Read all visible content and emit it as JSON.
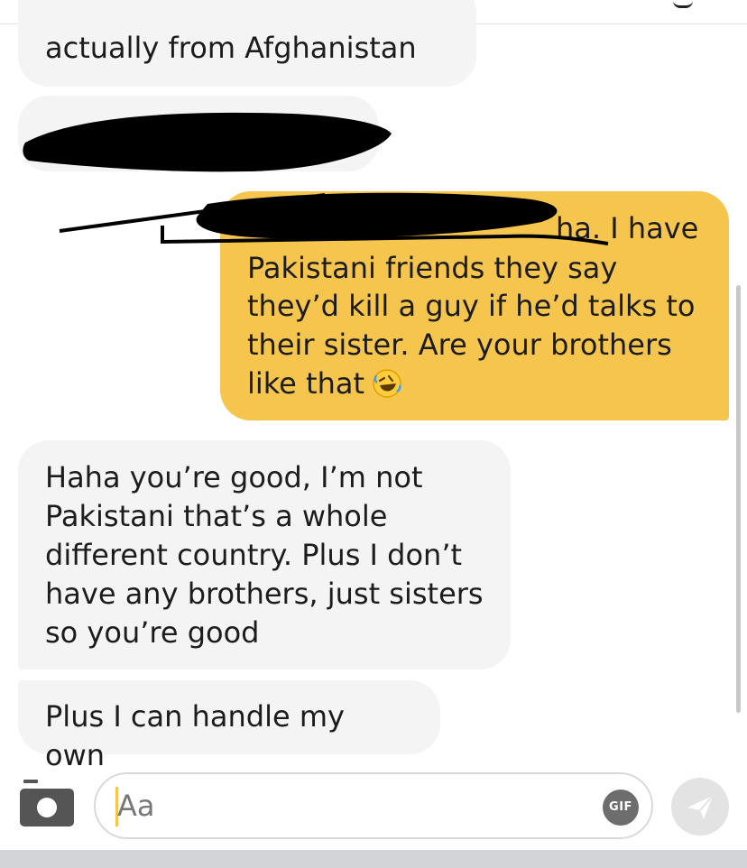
{
  "messages": [
    {
      "id": "msg1",
      "direction": "incoming",
      "text": "actually from Afghanistan"
    },
    {
      "id": "msg2",
      "direction": "incoming",
      "text": "",
      "redacted": true
    },
    {
      "id": "msg3",
      "direction": "outgoing",
      "line1": "ha. I have",
      "line2": "Pakistani friends they say",
      "body": "they’d kill a guy if he’d talks to\ntheir sister. Are your brothers\nlike that",
      "emoji": "rolling-on-floor-laughing-icon",
      "partially_redacted": true
    },
    {
      "id": "msg4",
      "direction": "incoming",
      "text": "Haha you’re good, I’m not\nPakistani that’s a whole\ndifferent country. Plus I don’t\nhave any brothers, just sisters\nso you’re good"
    },
    {
      "id": "msg5",
      "direction": "incoming",
      "text": "Plus I can handle my own"
    }
  ],
  "composer": {
    "placeholder": "Aa",
    "gif_label": "GIF",
    "camera_icon": "camera-icon",
    "send_icon": "send-icon"
  },
  "colors": {
    "incoming_bubble": "#f4f4f4",
    "outgoing_bubble": "#f5c54e",
    "text": "#1c1c1c",
    "gif_button": "#6d6d6d",
    "send_button": "#e3e3e3"
  }
}
